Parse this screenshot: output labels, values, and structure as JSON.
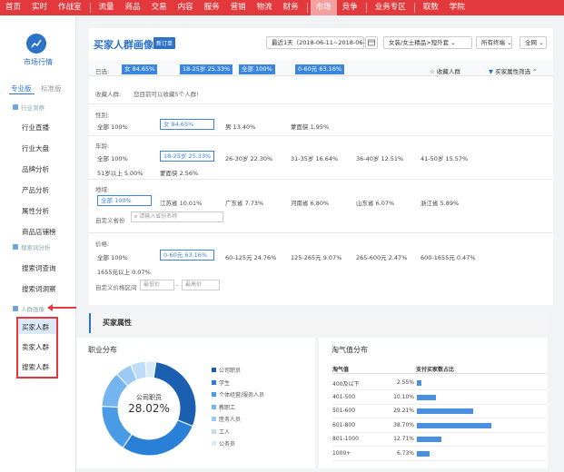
{
  "topnav": [
    {
      "label": "首页"
    },
    {
      "label": "实时"
    },
    {
      "label": "作战室",
      "dot": true
    },
    {
      "label": "流量"
    },
    {
      "label": "商品"
    },
    {
      "label": "交易"
    },
    {
      "label": "内容",
      "dot": true
    },
    {
      "label": "服务"
    },
    {
      "label": "营销"
    },
    {
      "label": "物流"
    },
    {
      "label": "财务"
    },
    {
      "label": "市场",
      "active": true
    },
    {
      "label": "竞争"
    },
    {
      "label": "业务专区"
    },
    {
      "label": "取数"
    },
    {
      "label": "学院"
    }
  ],
  "sidebar": {
    "title": "市场行情",
    "version_pro": "专业版",
    "version_std": "标准版",
    "sec1": "行业洞察",
    "sec1_items": [
      "行业直播",
      "行业大盘",
      "品牌分析",
      "产品分析",
      "属性分析",
      "商品店铺榜"
    ],
    "sec2": "搜索词分析",
    "sec2_items": [
      "搜索词查询",
      "搜索词洞察"
    ],
    "sec3": "人群画像",
    "sec3_items": [
      "买家人群",
      "卖家人群",
      "搜索人群"
    ]
  },
  "header": {
    "title": "买家人群画像",
    "badge": "新订单",
    "date_range": "最近1天（2018-06-11~2018-06-11）",
    "category": "女装/女士精品>短外套",
    "terminal": "所有终端",
    "network": "全网"
  },
  "selected": {
    "label": "已选:",
    "chips": [
      "女 84.65%",
      "18-25岁 25.33%",
      "全部 100%",
      "0-60元 63.16%"
    ],
    "collect": "收藏人群",
    "filter": "买家属性筛选"
  },
  "collected": {
    "label": "收藏人群:",
    "hint": "您目前可以收藏5个人群!"
  },
  "gender": {
    "label": "性别:",
    "items": [
      "全部   100%",
      "女   84.65%",
      "男   13.40%",
      "蒙面侠   1.95%"
    ]
  },
  "age": {
    "label": "年龄:",
    "items": [
      "全部   100%",
      "18-25岁   25.33%",
      "26-30岁   22.30%",
      "31-35岁   16.64%",
      "36-40岁   12.51%",
      "41-50岁   15.57%",
      "51岁以上   5.00%",
      "蒙面侠   2.56%"
    ]
  },
  "region": {
    "label": "地域:",
    "items": [
      "全部   100%",
      "江苏省   10.01%",
      "广东省   7.73%",
      "河南省   6.80%",
      "山东省   6.07%",
      "浙江省   5.89%"
    ],
    "custom_label": "自定义省份",
    "placeholder": "请输入省份名称"
  },
  "price": {
    "label": "价格:",
    "items": [
      "全部   100%",
      "0-60元   63.16%",
      "60-125元   24.76%",
      "125-265元   9.07%",
      "265-600元   2.47%",
      "600-1655元   0.47%",
      "1655元以上   0.07%"
    ],
    "custom_label": "自定义价格区间",
    "min_placeholder": "最低价",
    "max_placeholder": "最高价",
    "dash": "-"
  },
  "attributes": {
    "title": "买家属性"
  },
  "occupation": {
    "title": "职业分布",
    "center_label": "公司职员",
    "center_value": "28.02%",
    "legend": [
      "公司职员",
      "学生",
      "个体经营/服务人员",
      "教职工",
      "医务人员",
      "工人",
      "公务员"
    ],
    "values": [
      28.02,
      27.5,
      16.0,
      12.0,
      5.5,
      5.0,
      3.5
    ],
    "colors": [
      "#1b5fb0",
      "#2a7fd6",
      "#4a9be6",
      "#74b4ef",
      "#9dcaf4",
      "#bcdcf8",
      "#d7ebfb"
    ]
  },
  "taoqi": {
    "title": "淘气值分布",
    "col1": "淘气值",
    "col2": "支付买家数占比",
    "rows": [
      {
        "label": "400及以下",
        "pct": "2.55%",
        "value": 2.55
      },
      {
        "label": "401-500",
        "pct": "10.10%",
        "value": 10.1
      },
      {
        "label": "501-600",
        "pct": "29.21%",
        "value": 29.21
      },
      {
        "label": "601-800",
        "pct": "38.70%",
        "value": 38.7
      },
      {
        "label": "801-1000",
        "pct": "12.71%",
        "value": 12.71
      },
      {
        "label": "1000+",
        "pct": "6.73%",
        "value": 6.73
      }
    ]
  }
}
